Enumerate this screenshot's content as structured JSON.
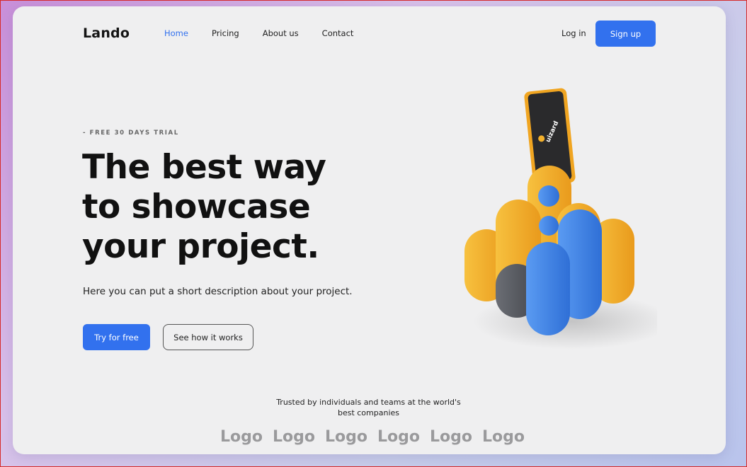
{
  "header": {
    "brand": "Lando",
    "nav": [
      {
        "label": "Home",
        "active": true
      },
      {
        "label": "Pricing",
        "active": false
      },
      {
        "label": "About us",
        "active": false
      },
      {
        "label": "Contact",
        "active": false
      }
    ],
    "login_label": "Log in",
    "signup_label": "Sign up"
  },
  "hero": {
    "eyebrow": "- FREE 30 DAYS TRIAL",
    "headline_lines": [
      "The best way",
      "to showcase",
      "your project."
    ],
    "description": "Here you can put a short description about your project.",
    "primary_cta": "Try for free",
    "secondary_cta": "See how it works",
    "phone_brand": "uizard"
  },
  "trusted": {
    "text_lines": [
      "Trusted by individuals and teams at the world's",
      "best companies"
    ],
    "logos": [
      "Logo",
      "Logo",
      "Logo",
      "Logo",
      "Logo",
      "Logo"
    ]
  },
  "colors": {
    "accent": "#3271ee",
    "illustration_yellow": "#f3b02b",
    "illustration_blue": "#3b82e8",
    "illustration_gray": "#5c5f66"
  }
}
